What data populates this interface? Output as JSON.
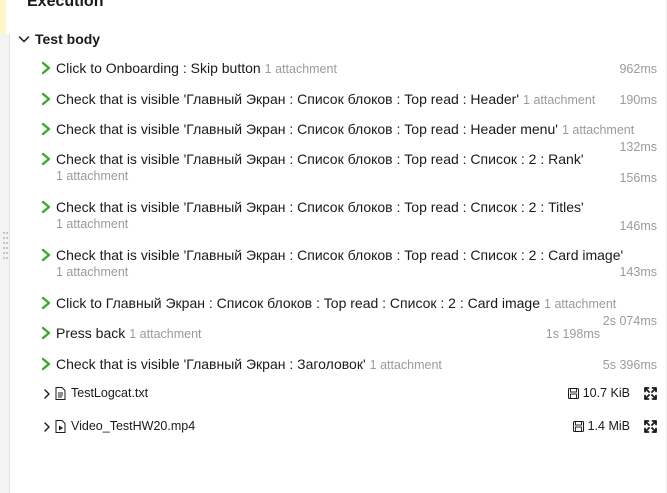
{
  "section": {
    "title": "Execution"
  },
  "test_body": {
    "title": "Test body",
    "expanded": true
  },
  "steps": [
    {
      "text": "Click to Onboarding : Skip button",
      "attachment": "1 attachment",
      "duration": "962ms"
    },
    {
      "text": "Check that is visible 'Главный Экран : Список блоков : Top read : Header'",
      "attachment": "1 attachment",
      "duration": "190ms"
    },
    {
      "text": "Check that is visible 'Главный Экран : Список блоков : Top read : Header menu'",
      "attachment": "1 attachment",
      "duration": "132ms"
    },
    {
      "text": "Check that is visible 'Главный Экран : Список блоков : Top read : Список : 2 : Rank'",
      "attachment": "1 attachment",
      "duration": "156ms"
    },
    {
      "text": "Check that is visible 'Главный Экран : Список блоков : Top read : Список : 2 : Titles'",
      "attachment": "1 attachment",
      "duration": "146ms"
    },
    {
      "text": "Check that is visible 'Главный Экран : Список блоков : Top read : Список : 2 : Card image'",
      "attachment": "1 attachment",
      "duration": "143ms"
    },
    {
      "text": "Click to Главный Экран : Список блоков : Top read : Список : 2 : Card image",
      "attachment": "1 attachment",
      "duration": "2s 074ms"
    },
    {
      "text": "Press back",
      "attachment": "1 attachment",
      "duration": "1s 198ms"
    },
    {
      "text": "Check that is visible 'Главный Экран : Заголовок'",
      "attachment": "1 attachment",
      "duration": "5s 396ms"
    }
  ],
  "files": [
    {
      "name": "TestLogcat.txt",
      "size": "10.7 KiB",
      "icon": "text-file-icon"
    },
    {
      "name": "Video_TestHW20.mp4",
      "size": "1.4 MiB",
      "icon": "video-file-icon"
    }
  ],
  "colors": {
    "check": "#3fa535",
    "muted": "#9b9b9b",
    "text": "#1a1a1a",
    "accent": "#fdf6c7"
  }
}
